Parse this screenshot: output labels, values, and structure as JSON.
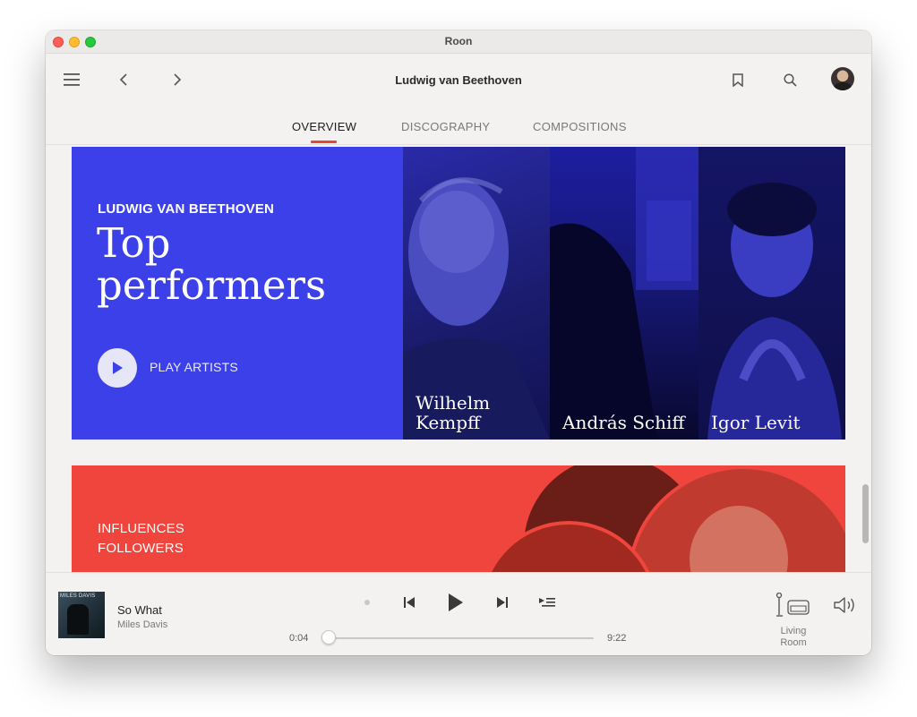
{
  "window": {
    "title": "Roon"
  },
  "header": {
    "title": "Ludwig van Beethoven",
    "icons": {
      "menu": "hamburger-icon",
      "back": "chevron-left-icon",
      "forward": "chevron-right-icon",
      "bookmark": "bookmark-icon",
      "search": "search-icon",
      "profile": "avatar"
    }
  },
  "tabs": [
    {
      "label": "OVERVIEW",
      "active": true
    },
    {
      "label": "DISCOGRAPHY",
      "active": false
    },
    {
      "label": "COMPOSITIONS",
      "active": false
    }
  ],
  "hero": {
    "label": "LUDWIG VAN BEETHOVEN",
    "title": "Top performers",
    "play_label": "PLAY ARTISTS",
    "color": "#3c40e8",
    "performers": [
      {
        "name_line1": "Wilhelm",
        "name_line2": "Kempff"
      },
      {
        "name_line1": "",
        "name_line2": "András Schiff"
      },
      {
        "name_line1": "",
        "name_line2": "Igor Levit"
      }
    ]
  },
  "influences": {
    "line1": "INFLUENCES",
    "line2": "FOLLOWERS",
    "color": "#f0453c"
  },
  "player": {
    "album_text": "MILES DAVIS",
    "track_title": "So What",
    "track_artist": "Miles Davis",
    "elapsed": "0:04",
    "duration": "9:22",
    "progress_fraction": 0.007,
    "zone": "Living Room",
    "icons": {
      "radio": "dot-icon",
      "previous": "previous-track-icon",
      "play": "play-icon",
      "next": "next-track-icon",
      "queue": "queue-icon",
      "zone": "zone-device-icon",
      "volume": "volume-icon"
    }
  }
}
